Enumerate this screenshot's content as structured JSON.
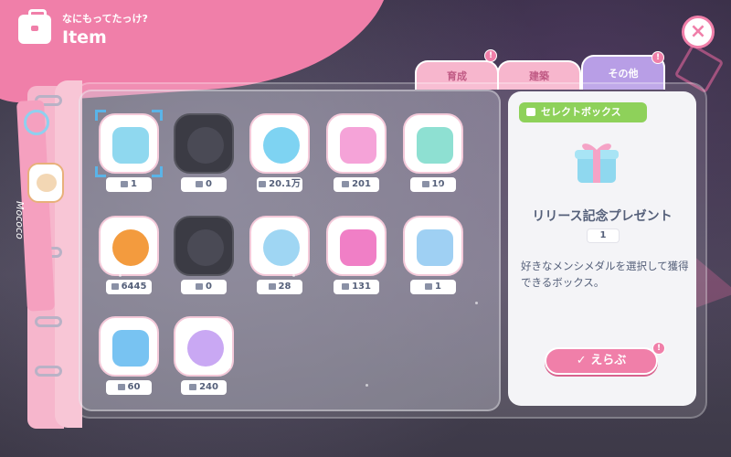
{
  "header": {
    "subtitle": "なにもってたっけ?",
    "title": "Item",
    "icon": "bag-icon"
  },
  "close": {
    "label": "×",
    "icon": "close-icon"
  },
  "binder": {
    "strap_text": "Mococo"
  },
  "tabs": [
    {
      "label": "育成",
      "active": false,
      "notif": "!"
    },
    {
      "label": "建築",
      "active": false,
      "notif": ""
    },
    {
      "label": "その他",
      "active": true,
      "notif": "!"
    }
  ],
  "items": [
    {
      "name": "gift-box",
      "count": "1",
      "color": "#8fd8ef",
      "dark": false,
      "selected": true
    },
    {
      "name": "ticket",
      "count": "0",
      "color": "#4a4a55",
      "dark": true,
      "selected": false
    },
    {
      "name": "play-coin",
      "count": "20.1万",
      "color": "#7ed3f2",
      "dark": false,
      "selected": false
    },
    {
      "name": "potion-bottle",
      "count": "201",
      "color": "#f5a3d8",
      "dark": false,
      "selected": false
    },
    {
      "name": "mb-bottle",
      "count": "10",
      "color": "#8ee0d2",
      "dark": false,
      "selected": false
    },
    {
      "name": "smile-coin",
      "count": "6445",
      "color": "#f39b3e",
      "dark": false,
      "selected": false
    },
    {
      "name": "dark-play-coin",
      "count": "0",
      "color": "#4a4a55",
      "dark": true,
      "selected": false
    },
    {
      "name": "music-card",
      "count": "28",
      "color": "#9fd6f3",
      "dark": false,
      "selected": false
    },
    {
      "name": "auto-ticket",
      "count": "131",
      "color": "#f07fc6",
      "dark": false,
      "selected": false
    },
    {
      "name": "envelope",
      "count": "1",
      "color": "#9fd0f3",
      "dark": false,
      "selected": false
    },
    {
      "name": "blue-shield-play",
      "count": "60",
      "color": "#78c3f2",
      "dark": false,
      "selected": false
    },
    {
      "name": "rainbow-shield-play",
      "count": "240",
      "color": "#c9a8f3",
      "dark": false,
      "selected": false
    }
  ],
  "detail": {
    "tag": "セレクトボックス",
    "name": "リリース記念プレゼント",
    "count": "1",
    "description": "好きなメンシメダルを選択して獲得できるボックス。",
    "button": "✓ えらぶ",
    "button_notif": "!"
  },
  "colors": {
    "accent": "#f07fa9",
    "tab_active": "#b89ee6",
    "tag_green": "#8ed15a",
    "text_slate": "#55607a"
  }
}
